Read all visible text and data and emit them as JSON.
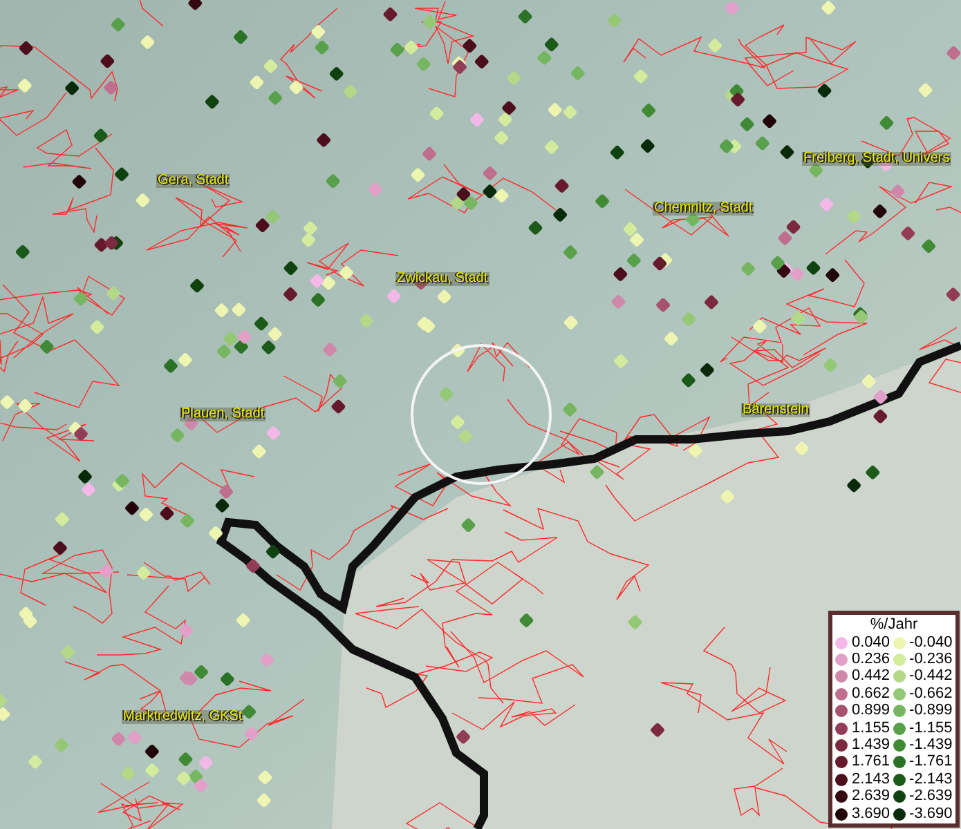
{
  "places": [
    {
      "name": "Gera, Stadt"
    },
    {
      "name": "Freiberg, Stadt, Univers"
    },
    {
      "name": "Chemnitz, Stadt"
    },
    {
      "name": "Zwickau, Stadt"
    },
    {
      "name": "Plauen, Stadt"
    },
    {
      "name": "Bärenstein"
    },
    {
      "name": "Marktredwitz, GKSt"
    }
  ],
  "legend": {
    "title": "%/Jahr",
    "columns": [
      [
        {
          "label": "0.040",
          "color": "#f4b8e8"
        },
        {
          "label": "0.236",
          "color": "#e2a0c8"
        },
        {
          "label": "0.442",
          "color": "#d088aa"
        },
        {
          "label": "0.662",
          "color": "#bf6e8e"
        },
        {
          "label": "0.899",
          "color": "#a85270"
        },
        {
          "label": "1.155",
          "color": "#933c58"
        },
        {
          "label": "1.439",
          "color": "#7c2840"
        },
        {
          "label": "1.761",
          "color": "#661a2c"
        },
        {
          "label": "2.143",
          "color": "#4c0e1c"
        },
        {
          "label": "2.639",
          "color": "#360812"
        },
        {
          "label": "3.690",
          "color": "#200408"
        }
      ],
      [
        {
          "label": "-0.040",
          "color": "#eef5b0"
        },
        {
          "label": "-0.236",
          "color": "#d2eb9c"
        },
        {
          "label": "-0.442",
          "color": "#b2d888"
        },
        {
          "label": "-0.662",
          "color": "#94c874"
        },
        {
          "label": "-0.899",
          "color": "#76b660"
        },
        {
          "label": "-1.155",
          "color": "#58a04a"
        },
        {
          "label": "-1.439",
          "color": "#408a36"
        },
        {
          "label": "-1.761",
          "color": "#2c7226"
        },
        {
          "label": "-2.143",
          "color": "#1c5a1a"
        },
        {
          "label": "-2.639",
          "color": "#104210"
        },
        {
          "label": "-3.690",
          "color": "#082a08"
        }
      ]
    ]
  }
}
